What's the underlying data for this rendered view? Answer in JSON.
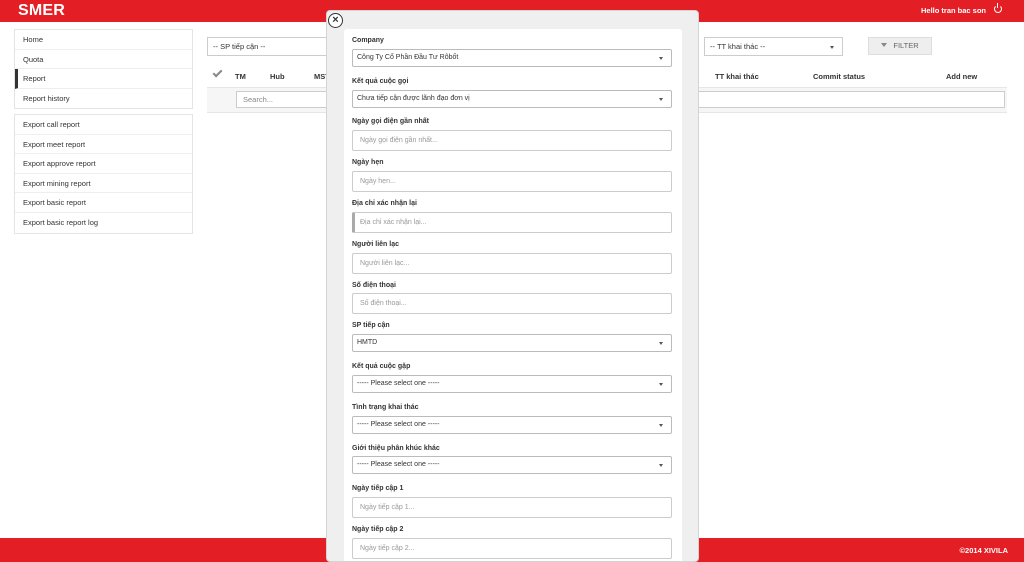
{
  "header": {
    "logo": "SMER",
    "greeting": "Hello tran bac son"
  },
  "footer": {
    "copyright": "©2014 XIVILA"
  },
  "sidebar": {
    "nav": [
      "Home",
      "Quota",
      "Report",
      "Report history"
    ],
    "exports": [
      "Export call report",
      "Export meet report",
      "Export approve report",
      "Export mining report",
      "Export basic report",
      "Export basic report log"
    ]
  },
  "filters": {
    "sp_tiep_can": "-- SP tiếp cận --",
    "tt_khai_thac": "-- TT khai thác --",
    "filter_button": "FILTER"
  },
  "table": {
    "headers": {
      "tm": "TM",
      "hub": "Hub",
      "mst": "MST",
      "tt_khai_thac": "TT khai thác",
      "commit_status": "Commit status",
      "add_new": "Add new"
    },
    "search_placeholder": "Search..."
  },
  "modal": {
    "fields": [
      {
        "label": "Company",
        "type": "select",
        "value": "Công Ty Cổ Phần Đầu Tư Rôbốt"
      },
      {
        "label": "Kết quả cuộc gọi",
        "type": "select",
        "value": "Chưa tiếp cận được lãnh đạo đơn vị"
      },
      {
        "label": "Ngày gọi điện gần nhất",
        "type": "input",
        "placeholder": "Ngày gọi điện gần nhất..."
      },
      {
        "label": "Ngày hẹn",
        "type": "input",
        "placeholder": "Ngày hẹn..."
      },
      {
        "label": "Địa chỉ xác nhận lại",
        "type": "input",
        "placeholder": "Địa chỉ xác nhận lại..."
      },
      {
        "label": "Người liên lạc",
        "type": "input",
        "placeholder": "Người liên lạc..."
      },
      {
        "label": "Số điện thoại",
        "type": "input",
        "placeholder": "Số điện thoại..."
      },
      {
        "label": "SP tiếp cận",
        "type": "select",
        "value": "HMTD"
      },
      {
        "label": "Kết quả cuộc gặp",
        "type": "select",
        "value": "----- Please select one -----"
      },
      {
        "label": "Tình trạng khai thác",
        "type": "select",
        "value": "----- Please select one -----"
      },
      {
        "label": "Giới thiệu phân khúc khác",
        "type": "select",
        "value": "----- Please select one -----"
      },
      {
        "label": "Ngày tiếp cập 1",
        "type": "input",
        "placeholder": "Ngày tiếp cập 1..."
      },
      {
        "label": "Ngày tiếp cập 2",
        "type": "input",
        "placeholder": "Ngày tiếp cập 2..."
      }
    ]
  }
}
